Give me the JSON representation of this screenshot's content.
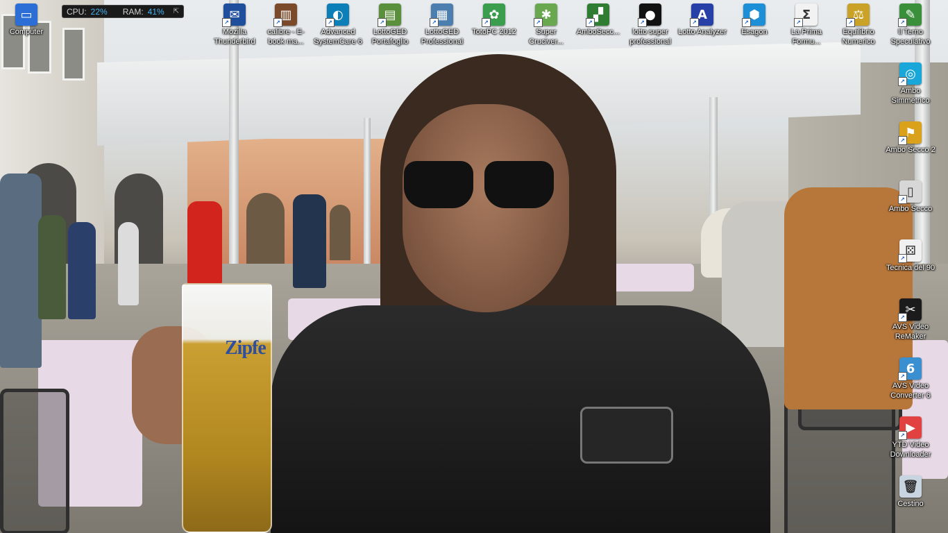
{
  "gadget": {
    "cpu_label": "CPU:",
    "cpu_value": "22%",
    "ram_label": "RAM:",
    "ram_value": "41%"
  },
  "wallpaper": {
    "beer_brand": "Zipfe"
  },
  "desktop_icons": [
    {
      "name": "computer",
      "label": "Computer",
      "color": "#2b6fd6",
      "glyph": "▭"
    },
    {
      "name": "mozilla-thunderbird",
      "label": "Mozilla Thunderbird",
      "color": "#1f4e9c",
      "glyph": "✉"
    },
    {
      "name": "calibre",
      "label": "calibre - E-book ma...",
      "color": "#7b4a2a",
      "glyph": "▥"
    },
    {
      "name": "advanced-systemcare",
      "label": "Advanced SystemCare 6",
      "color": "#0c7fb8",
      "glyph": "◐"
    },
    {
      "name": "lottoged-portafoglio",
      "label": "LottoGED Portafoglio",
      "color": "#5a8f3c",
      "glyph": "▤"
    },
    {
      "name": "lottoged-professional",
      "label": "LottoGED Professional",
      "color": "#4c7fb0",
      "glyph": "▦"
    },
    {
      "name": "totopc-2012",
      "label": "TotoPC 2012",
      "color": "#3b9d4e",
      "glyph": "✿"
    },
    {
      "name": "super-cruciverba",
      "label": "Super Cruciver...",
      "color": "#6aa84f",
      "glyph": "✱"
    },
    {
      "name": "ambosecco",
      "label": "AmboSecc...",
      "color": "#2e7d32",
      "glyph": "▞"
    },
    {
      "name": "lotto-super-professional",
      "label": "lotto super professional",
      "color": "#111111",
      "glyph": "●"
    },
    {
      "name": "lotto-analyzer",
      "label": "Lotto Analyzer",
      "color": "#2740a8",
      "glyph": "A"
    },
    {
      "name": "esagon",
      "label": "Esagon",
      "color": "#1d8fd6",
      "glyph": "⬢"
    },
    {
      "name": "la-prima-formula",
      "label": "La Prima Formu...",
      "color": "#f2f2f2",
      "glyph": "Σ"
    },
    {
      "name": "equilibrio-numerico",
      "label": "Equilibrio Numerico",
      "color": "#c9a227",
      "glyph": "⚖"
    },
    {
      "name": "il-terno-speculativo",
      "label": "Il Terno Speculativo",
      "color": "#3a8f3a",
      "glyph": "✎"
    },
    {
      "name": "ambo-simmetrico",
      "label": "Ambo Simmetrico",
      "color": "#19a6d9",
      "glyph": "◎"
    },
    {
      "name": "ambo-secco-2",
      "label": "Ambo Secco 2",
      "color": "#d9a21a",
      "glyph": "⚑"
    },
    {
      "name": "ambo-secco",
      "label": "Ambo Secco",
      "color": "#d7d7d7",
      "glyph": "▯"
    },
    {
      "name": "tecnica-del-90",
      "label": "Tecnica del 90",
      "color": "#f0f0f0",
      "glyph": "⚄"
    },
    {
      "name": "avs-video-remaker",
      "label": "AVS Video ReMaker",
      "color": "#1b1b1b",
      "glyph": "✂"
    },
    {
      "name": "avs-video-converter",
      "label": "AVS Video Converter 6",
      "color": "#3a8fd0",
      "glyph": "6"
    },
    {
      "name": "ytd-video-downloader",
      "label": "YTD Video Downloader",
      "color": "#e24141",
      "glyph": "▶"
    },
    {
      "name": "cestino",
      "label": "Cestino",
      "color": "#c8d4e0",
      "glyph": "🗑"
    }
  ]
}
